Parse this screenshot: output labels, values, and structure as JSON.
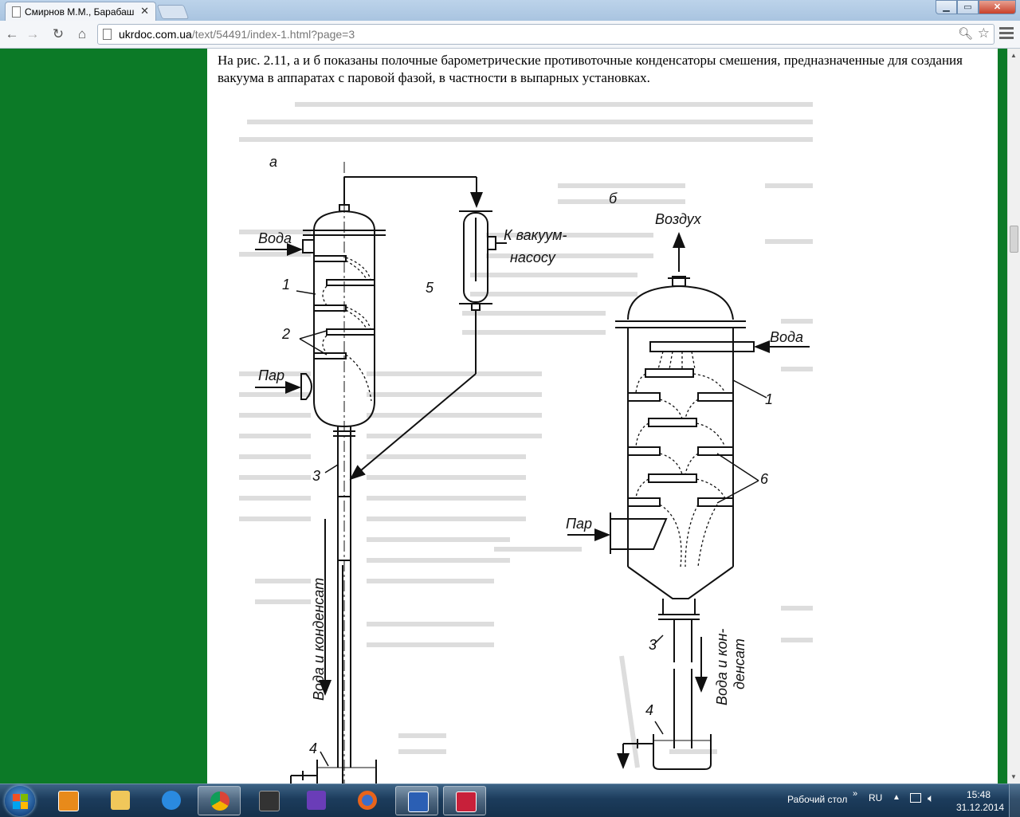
{
  "browser": {
    "tab_title": "Смирнов М.М., Барабаш",
    "url_host": "ukrdoc.com.ua",
    "url_path": "/text/54491/index-1.html?page=3"
  },
  "page": {
    "paragraph": "На рис. 2.11, а и б показаны полочные барометрические противоточные конденсаторы смешения, предназначенные для создания вакуума в аппаратах с паровой фазой, в частности в выпарных установках.",
    "figure": {
      "label_a": "а",
      "label_b": "б",
      "voda_a": "Вода",
      "par_a": "Пар",
      "vacuum_1": "К вакуум-",
      "vacuum_2": "насосу",
      "n1_a": "1",
      "n2_a": "2",
      "n3_a": "3",
      "n4_a": "4",
      "n5_a": "5",
      "outlet_a": "Вода и конденсат",
      "vozdukh": "Воздух",
      "voda_b": "Вода",
      "par_b": "Пар",
      "n1_b": "1",
      "n3_b": "3",
      "n4_b": "4",
      "n6_b": "6",
      "outlet_b1": "Вода и кон-",
      "outlet_b2": "денсат"
    }
  },
  "taskbar": {
    "desktop_label": "Рабочий стол",
    "lang": "RU",
    "time": "15:48",
    "date": "31.12.2014",
    "icons": [
      "media-player-icon",
      "file-explorer-icon",
      "internet-explorer-icon",
      "chrome-icon",
      "camera-app-icon",
      "app-purple-icon",
      "firefox-icon",
      "word-icon",
      "floppy-app-icon"
    ]
  },
  "colors": {
    "sidebar_green": "#0c7a27",
    "taskbar": "#1c3c5c"
  }
}
